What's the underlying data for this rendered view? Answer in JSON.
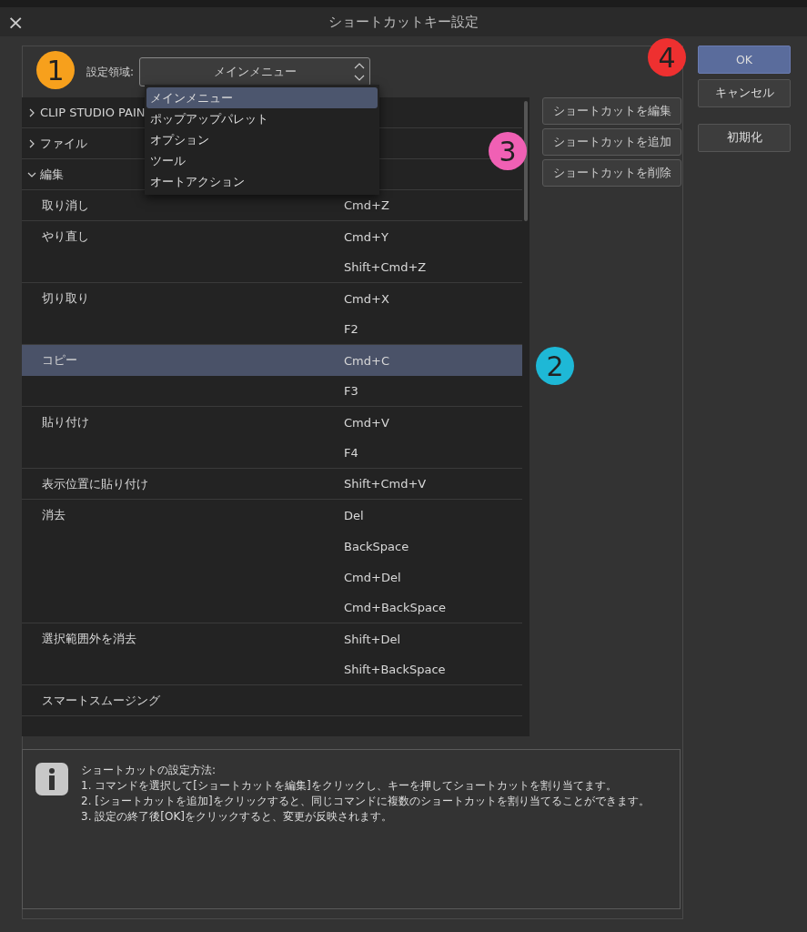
{
  "window": {
    "title": "ショートカットキー設定",
    "close": "×"
  },
  "setting_area": {
    "label": "設定領域:",
    "value": "メインメニュー",
    "expanded": true,
    "options": [
      {
        "label": "メインメニュー",
        "selected": true
      },
      {
        "label": "ポップアップパレット",
        "selected": false
      },
      {
        "label": "オプション",
        "selected": false
      },
      {
        "label": "ツール",
        "selected": false
      },
      {
        "label": "オートアクション",
        "selected": false
      }
    ]
  },
  "tree": [
    {
      "label": "CLIP STUDIO PAIN",
      "expanded": false
    },
    {
      "label": "ファイル",
      "expanded": false
    },
    {
      "label": "編集",
      "expanded": true,
      "children": [
        {
          "label": "取り消し",
          "shortcuts": [
            {
              "key": "Cmd+Z",
              "selected": false
            }
          ]
        },
        {
          "label": "やり直し",
          "shortcuts": [
            {
              "key": "Cmd+Y",
              "selected": false
            },
            {
              "key": "Shift+Cmd+Z",
              "selected": false
            }
          ]
        },
        {
          "label": "切り取り",
          "shortcuts": [
            {
              "key": "Cmd+X",
              "selected": false
            },
            {
              "key": "F2",
              "selected": false
            }
          ]
        },
        {
          "label": "コピー",
          "shortcuts": [
            {
              "key": "Cmd+C",
              "selected": true
            },
            {
              "key": "F3",
              "selected": false
            }
          ]
        },
        {
          "label": "貼り付け",
          "shortcuts": [
            {
              "key": "Cmd+V",
              "selected": false
            },
            {
              "key": "F4",
              "selected": false
            }
          ]
        },
        {
          "label": "表示位置に貼り付け",
          "shortcuts": [
            {
              "key": "Shift+Cmd+V",
              "selected": false
            }
          ]
        },
        {
          "label": "消去",
          "shortcuts": [
            {
              "key": "Del",
              "selected": false
            },
            {
              "key": "BackSpace",
              "selected": false
            },
            {
              "key": "Cmd+Del",
              "selected": false
            },
            {
              "key": "Cmd+BackSpace",
              "selected": false
            }
          ]
        },
        {
          "label": "選択範囲外を消去",
          "shortcuts": [
            {
              "key": "Shift+Del",
              "selected": false
            },
            {
              "key": "Shift+BackSpace",
              "selected": false
            }
          ]
        },
        {
          "label": "スマートスムージング"
        }
      ]
    }
  ],
  "actions": [
    "ショートカットを編集",
    "ショートカットを追加",
    "ショートカットを削除"
  ],
  "dialog_buttons": [
    {
      "label": "OK",
      "kind": "primary"
    },
    {
      "label": "キャンセル",
      "kind": "normal"
    },
    {
      "label": "初期化",
      "kind": "reset"
    }
  ],
  "info": {
    "lines": [
      "ショートカットの設定方法:",
      "1. コマンドを選択して[ショートカットを編集]をクリックし、キーを押してショートカットを割り当てます。",
      "2. [ショートカットを追加]をクリックすると、同じコマンドに複数のショートカットを割り当てることができます。",
      "3. 設定の終了後[OK]をクリックすると、変更が反映されます。"
    ]
  },
  "markers": [
    {
      "text": "1",
      "color": "#f7a01c"
    },
    {
      "text": "2",
      "color": "#1eb8d6"
    },
    {
      "text": "3",
      "color": "#f060b4"
    },
    {
      "text": "4",
      "color": "#ee3030"
    }
  ]
}
